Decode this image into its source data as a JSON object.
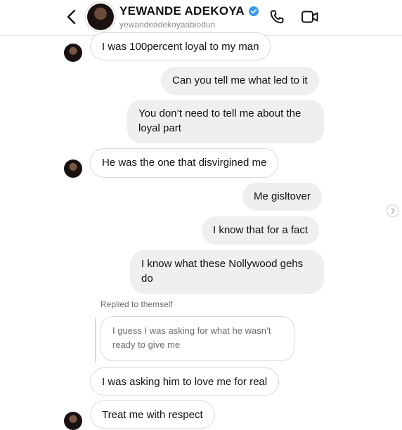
{
  "header": {
    "name": "YEWANDE ADEKOYA",
    "handle": "yewandeadekoyaabiodun",
    "verified_color": "#3897f0"
  },
  "icons": {
    "back": "chevron-left-icon",
    "call": "phone-icon",
    "video": "video-camera-icon",
    "verified": "verified-badge-icon",
    "next": "chevron-right-icon"
  },
  "messages": [
    {
      "from": "them",
      "text": "I was 100percent loyal to my man"
    },
    {
      "from": "me",
      "text": "Can you tell me what led to it"
    },
    {
      "from": "me",
      "text": "You don’t need to tell me about the loyal part"
    },
    {
      "from": "them",
      "text": "He was the one that disvirgined me"
    },
    {
      "from": "me",
      "text": "Me gisltover"
    },
    {
      "from": "me",
      "text": "I know that for a fact"
    },
    {
      "from": "me",
      "text": "I know what these Nollywood gehs do"
    },
    {
      "from": "them",
      "text": "I was asking him to love me for real"
    },
    {
      "from": "them",
      "text": "Treat me with respect"
    }
  ],
  "reply": {
    "label": "Replied to themself",
    "quoted_text": "I guess I was asking for what he wasn’t ready to give me"
  }
}
